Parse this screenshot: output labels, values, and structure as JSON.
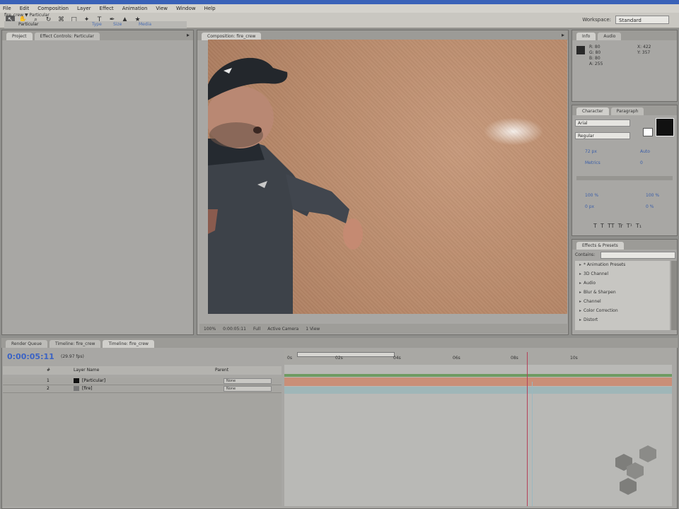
{
  "menu": [
    "File",
    "Edit",
    "Composition",
    "Layer",
    "Effect",
    "Animation",
    "View",
    "Window",
    "Help"
  ],
  "toolbar": {
    "tools": [
      "↖",
      "✋",
      "⌕",
      "↻",
      "⌘",
      "□",
      "✦",
      "T",
      "✒",
      "▲",
      "★"
    ],
    "workspace_label": "Workspace:",
    "workspace_value": "Standard"
  },
  "project": {
    "tabs": [
      "Project",
      "Effect Controls: Particular"
    ],
    "header": "fire_crew ▼ Particular",
    "column": "Particular",
    "links": [
      "Type",
      "Size",
      "Media"
    ]
  },
  "comp": {
    "tabs": [
      "Composition: fire_crew"
    ],
    "bottom_bar": [
      "100%",
      "0:00:05:11",
      "Full",
      "Active Camera",
      "1 View"
    ]
  },
  "info": {
    "tabs": [
      "Info",
      "Audio"
    ],
    "lines": [
      "R: 80",
      "G: 80",
      "B: 80",
      "A: 255",
      "X: 422",
      "Y: 357"
    ]
  },
  "character": {
    "tabs": [
      "Character",
      "Paragraph"
    ],
    "font": "Arial",
    "style": "Regular",
    "values": [
      "72 px",
      "Auto",
      "Metrics",
      "0",
      "100 %",
      "100 %",
      "0 px",
      "0 %"
    ]
  },
  "effects": {
    "tabs": [
      "Effects & Presets"
    ],
    "search_label": "Contains:",
    "items": [
      "* Animation Presets",
      "3D Channel",
      "Audio",
      "Blur & Sharpen",
      "Channel",
      "Color Correction",
      "Distort"
    ]
  },
  "timeline": {
    "tabs": [
      "Render Queue",
      "Timeline: fire_crew",
      "Timeline: fire_crew"
    ],
    "timecode": "0:00:05:11",
    "fps": "(29.97 fps)",
    "headers": [
      "#",
      "Layer Name",
      "Parent"
    ],
    "layers": [
      {
        "num": "1",
        "name": "[Particular]",
        "parent": "None"
      },
      {
        "num": "2",
        "name": "[fire]",
        "parent": "None"
      }
    ],
    "ruler": [
      "0s",
      "02s",
      "04s",
      "06s",
      "08s",
      "10s"
    ]
  },
  "colors": {
    "accent": "#3b63c4",
    "track_bar": "#c98f78",
    "playhead": "#b4425a"
  }
}
